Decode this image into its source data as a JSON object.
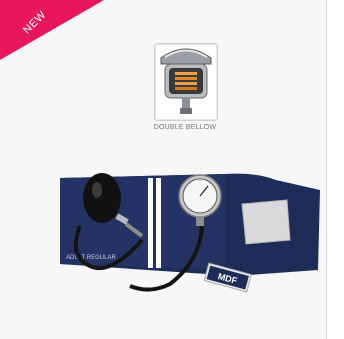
{
  "badge": {
    "label": "NEW",
    "color": "#e8175d"
  },
  "feature_thumbnail": {
    "caption": "DOUBLE BELLOW",
    "icon": "bellows-gauge-icon"
  },
  "product_image": {
    "icon": "blood-pressure-cuff-icon",
    "cuff_printed_text": "ADULT REGULAR",
    "tag_printed_text": "MDF",
    "cuff_color": "#1f2c57"
  }
}
